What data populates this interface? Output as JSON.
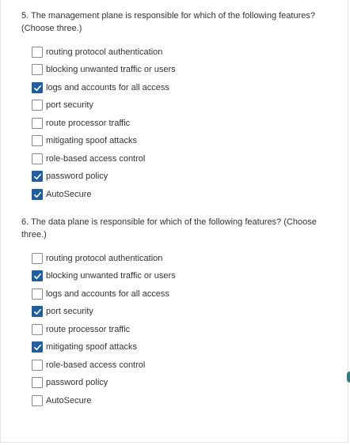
{
  "questions": [
    {
      "number": "5.",
      "text": "The management plane is responsible for which of the following features? (Choose three.)",
      "options": [
        {
          "label": "routing protocol authentication",
          "checked": false
        },
        {
          "label": "blocking unwanted traffic or users",
          "checked": false
        },
        {
          "label": "logs and accounts for all access",
          "checked": true
        },
        {
          "label": "port security",
          "checked": false
        },
        {
          "label": "route processor traffic",
          "checked": false
        },
        {
          "label": "mitigating spoof attacks",
          "checked": false
        },
        {
          "label": "role-based access control",
          "checked": false
        },
        {
          "label": "password policy",
          "checked": true
        },
        {
          "label": "AutoSecure",
          "checked": true
        }
      ]
    },
    {
      "number": "6.",
      "text": "The data plane is responsible for which of the following features? (Choose three.)",
      "options": [
        {
          "label": "routing protocol authentication",
          "checked": false
        },
        {
          "label": "blocking unwanted traffic or users",
          "checked": true
        },
        {
          "label": "logs and accounts for all access",
          "checked": false
        },
        {
          "label": "port security",
          "checked": true
        },
        {
          "label": "route processor traffic",
          "checked": false
        },
        {
          "label": "mitigating spoof attacks",
          "checked": true
        },
        {
          "label": "role-based access control",
          "checked": false
        },
        {
          "label": "password policy",
          "checked": false
        },
        {
          "label": "AutoSecure",
          "checked": false
        }
      ]
    }
  ],
  "colors": {
    "checkbox_checked": "#1f5f9f",
    "checkbox_border": "#8a8a8a",
    "text": "#333333",
    "edge_indicator": "#2f7a85"
  }
}
